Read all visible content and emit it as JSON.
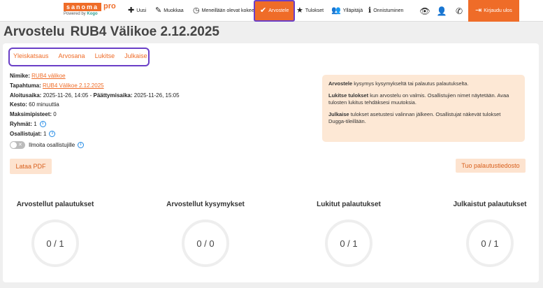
{
  "logo": {
    "brand": "sanoma",
    "pro": "pro",
    "powered": "Powered by",
    "partner": "Kogo"
  },
  "nav": {
    "uusi": "Uusi",
    "muokkaa": "Muokkaa",
    "meneillaan": "Meneillään olevat kokeet",
    "arvostele": "Arvostele",
    "tulokset": "Tulokset",
    "yllapitaja": "Ylläpitäjä",
    "onnistuminen": "Onnistuminen",
    "logout": "Kirjaudu ulos"
  },
  "page": {
    "title": "Arvostelu",
    "code": "RUB4 Välikoe 2.12.2025"
  },
  "tabs": [
    "Yleiskatsaus",
    "Arvosana",
    "Lukitse",
    "Julkaise"
  ],
  "tabs_more": "···",
  "details": {
    "nimike_label": "Nimike:",
    "nimike_value": "RUB4 välikoe",
    "tapahtuma_label": "Tapahtuma:",
    "tapahtuma_value": "RUB4 Välikoe 2.12.2025",
    "aloitus_label": "Aloitusaika:",
    "aloitus_value": "2025-11-26, 14:05",
    "paattymis_label": "Päättymisaika:",
    "paattymis_value": "2025-11-26, 15:05",
    "kesto_label": "Kesto:",
    "kesto_value": "60 minuuttia",
    "maksimi_label": "Maksimipisteet:",
    "maksimi_value": "0",
    "ryhmat_label": "Ryhmät:",
    "ryhmat_value": "1",
    "osallistujat_label": "Osallistujat:",
    "osallistujat_value": "1",
    "ilmoita_label": "Ilmoita osallistujille"
  },
  "help": {
    "p1_bold": "Arvostele",
    "p1_text": " kysymys kysymykseltä tai palautus palautukselta.",
    "p2_bold": "Lukitse tulokset",
    "p2_text": " kun arvostelu on valmis. Osallistujien nimet näytetään. Avaa tulosten lukitus tehdäksesi muutoksia.",
    "p3_bold": "Julkaise",
    "p3_text": " tulokset asetustesi valinnan jälkeen. Osallistujat näkevät tulokset Dugga-tileillään."
  },
  "buttons": {
    "pdf": "Lataa PDF",
    "import": "Tuo palautustiedosto"
  },
  "stats": [
    {
      "label": "Arvostellut palautukset",
      "value": "0 / 1"
    },
    {
      "label": "Arvostellut kysymykset",
      "value": "0 / 0"
    },
    {
      "label": "Lukitut palautukset",
      "value": "0 / 1"
    },
    {
      "label": "Julkaistut palautukset",
      "value": "0 / 1"
    }
  ],
  "colors": {
    "accent": "#ef6c28",
    "highlight": "#6a3fc7",
    "info": "#1e88e5"
  }
}
